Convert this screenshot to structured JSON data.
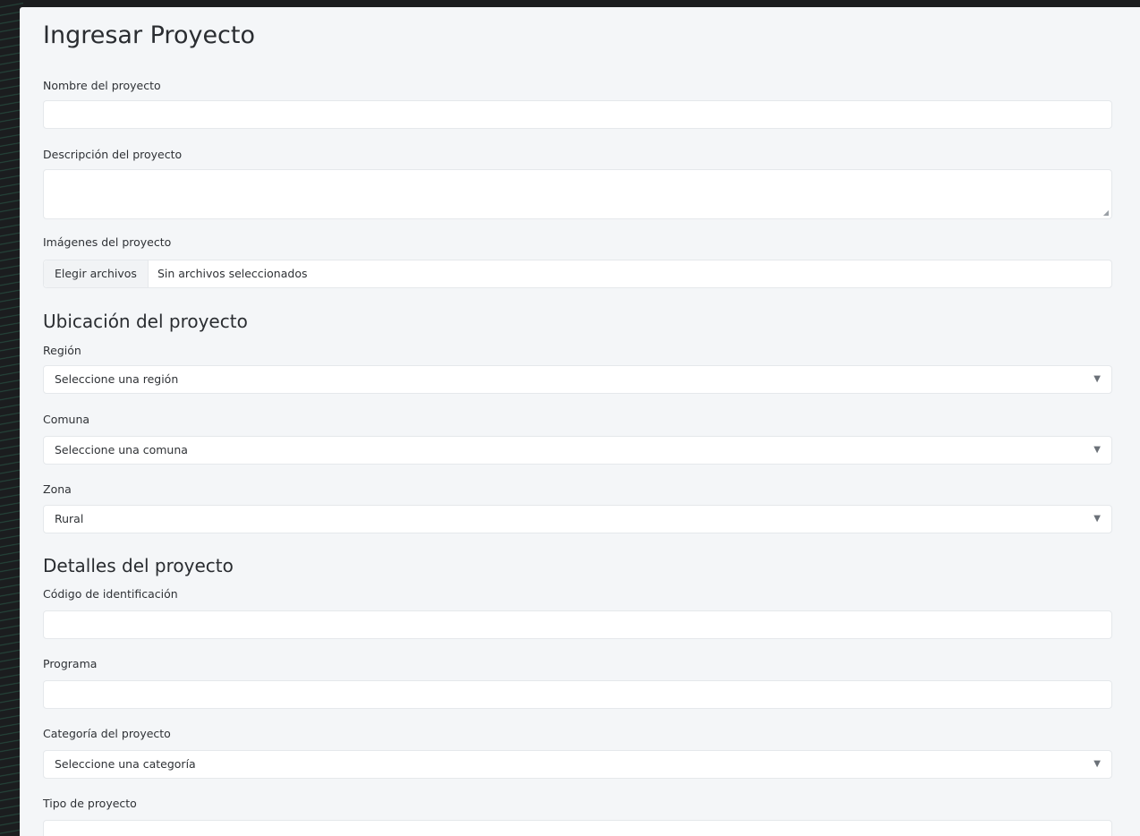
{
  "form": {
    "title": "Ingresar Proyecto",
    "name_label": "Nombre del proyecto",
    "name_value": "",
    "description_label": "Descripción del proyecto",
    "description_value": "",
    "images_label": "Imágenes del proyecto",
    "images_button": "Elegir archivos",
    "images_status": "Sin archivos seleccionados",
    "location_heading": "Ubicación del proyecto",
    "region_label": "Región",
    "region_value": "Seleccione una región",
    "comuna_label": "Comuna",
    "comuna_value": "Seleccione una comuna",
    "zona_label": "Zona",
    "zona_value": "Rural",
    "details_heading": "Detalles del proyecto",
    "code_label": "Código de identificación",
    "code_value": "",
    "programa_label": "Programa",
    "programa_value": "",
    "category_label": "Categoría del proyecto",
    "category_value": "Seleccione una categoría",
    "type_label": "Tipo de proyecto",
    "type_value": ""
  },
  "icons": {
    "chevron": "chevron-down-icon",
    "resize": "resize-handle-icon"
  },
  "colors": {
    "panel_bg": "#f4f6f8",
    "page_bg": "#1b1d1f",
    "accent_pattern": "#2f6e56"
  }
}
